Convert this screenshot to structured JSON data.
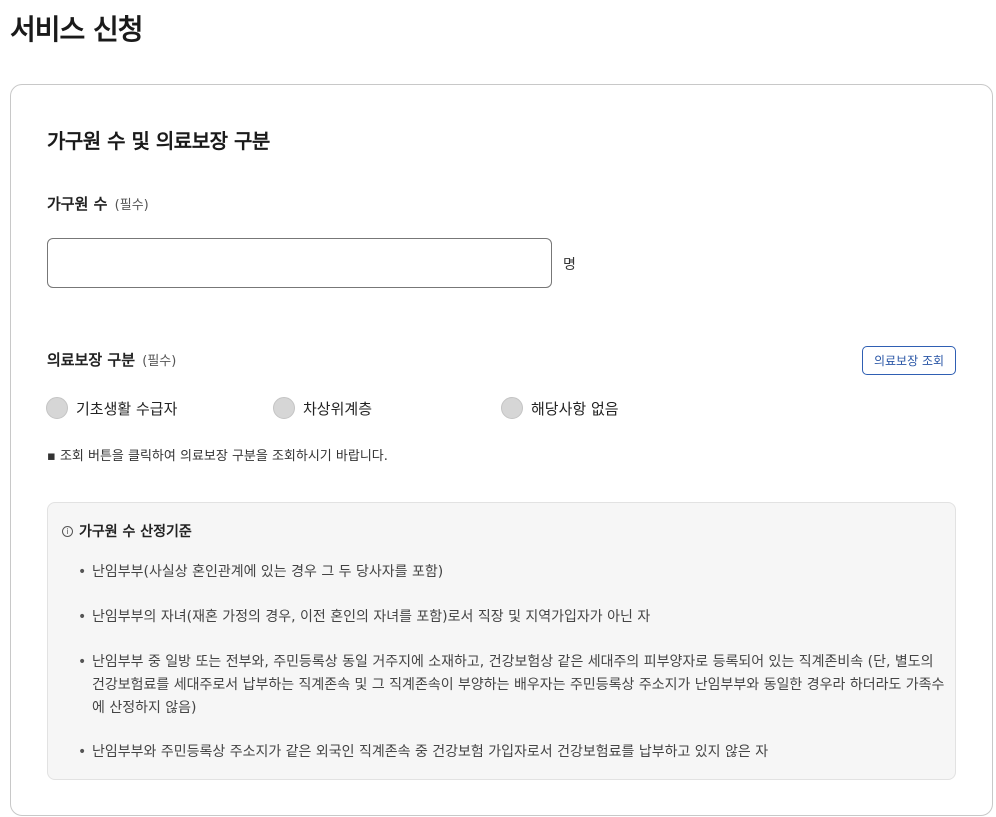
{
  "page": {
    "title": "서비스 신청"
  },
  "section": {
    "title": "가구원 수 및 의료보장 구분"
  },
  "household": {
    "label": "가구원 수",
    "required": "(필수)",
    "value": "",
    "placeholder": "",
    "unit": "명"
  },
  "medical": {
    "label": "의료보장 구분",
    "required": "(필수)",
    "lookup_button": "의료보장 조회",
    "options": [
      "기초생활 수급자",
      "차상위계층",
      "해당사항 없음"
    ],
    "hint": "▪ 조회 버튼을 클릭하여 의료보장 구분을 조회하시기 바랍니다."
  },
  "criteria": {
    "icon": "info-icon",
    "icon_glyph": "i",
    "title": "가구원 수 산정기준",
    "bullet": "•",
    "items": [
      "난임부부(사실상 혼인관계에 있는 경우 그 두 당사자를 포함)",
      "난임부부의 자녀(재혼 가정의 경우, 이전 혼인의 자녀를 포함)로서 직장 및 지역가입자가 아닌 자",
      "난임부부 중 일방 또는 전부와, 주민등록상 동일 거주지에 소재하고, 건강보험상 같은 세대주의 피부양자로 등록되어 있는 직계존비속 (단, 별도의 건강보험료를 세대주로서 납부하는 직계존속 및 그 직계존속이 부양하는 배우자는 주민등록상 주소지가 난임부부와 동일한 경우라 하더라도 가족수에 산정하지 않음)",
      "난임부부와 주민등록상 주소지가 같은 외국인 직계존속 중 건강보험 가입자로서 건강보험료를 납부하고 있지 않은 자"
    ]
  },
  "colors": {
    "accent": "#2a56a6",
    "radio_fill": "#d6d6d6",
    "info_bg": "#f6f6f6"
  }
}
